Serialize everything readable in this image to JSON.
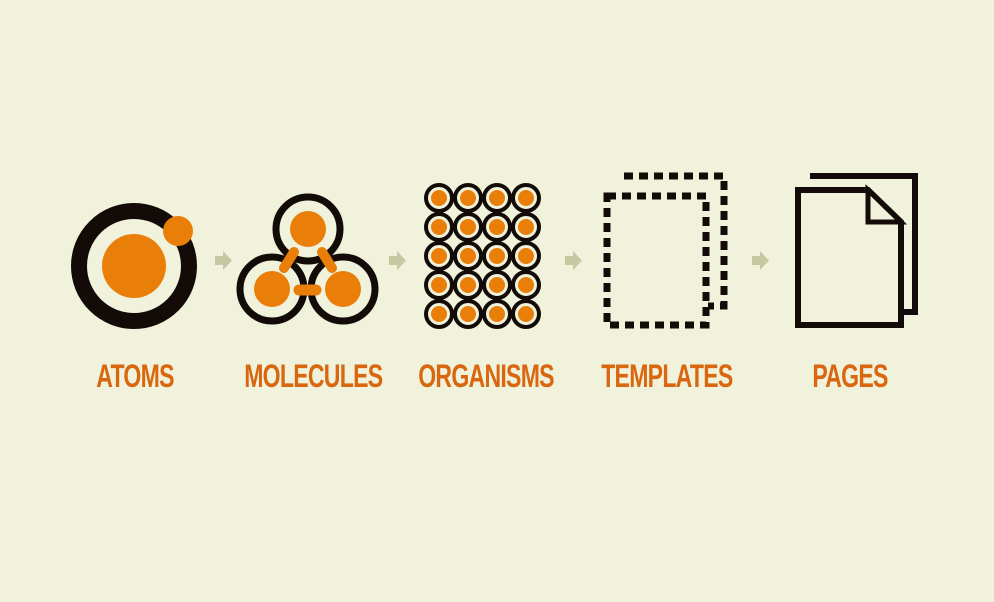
{
  "colors": {
    "background": "#f1f2db",
    "accent": "#e97f08",
    "ink": "#130b08",
    "label": "#d8670f",
    "arrow": "#c4c9a2"
  },
  "stages": [
    {
      "label": "ATOMS",
      "icon": "atom-icon"
    },
    {
      "label": "MOLECULES",
      "icon": "molecule-icon"
    },
    {
      "label": "ORGANISMS",
      "icon": "organism-icon"
    },
    {
      "label": "TEMPLATES",
      "icon": "template-icon"
    },
    {
      "label": "PAGES",
      "icon": "pages-icon"
    }
  ]
}
